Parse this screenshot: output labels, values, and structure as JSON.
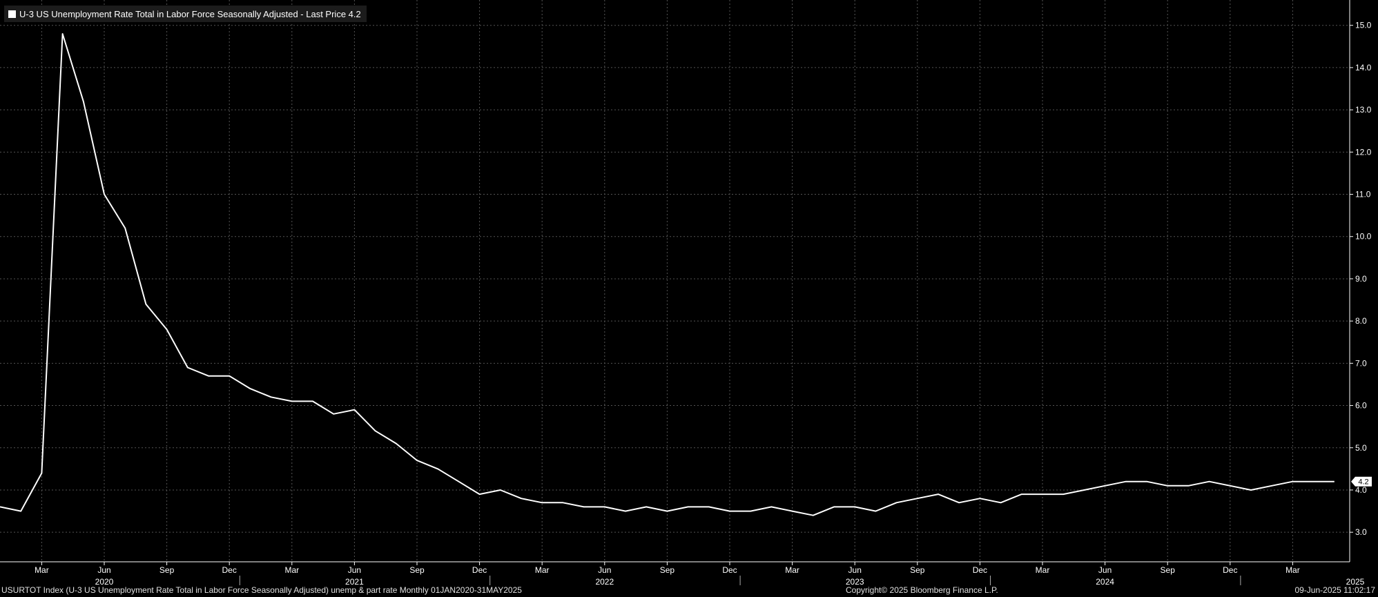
{
  "legend": {
    "label": "U-3 US Unemployment Rate Total in Labor Force Seasonally Adjusted - Last Price 4.2"
  },
  "footer": {
    "left": "USURTOT Index (U-3 US Unemployment Rate Total in Labor Force Seasonally Adjusted) unemp & part rate  Monthly 01JAN2020-31MAY2025",
    "copyright": "Copyright© 2025 Bloomberg Finance L.P.",
    "timestamp": "09-Jun-2025 11:02:17"
  },
  "colors": {
    "background": "#000000",
    "line": "#ffffff",
    "grid": "#555555"
  },
  "chart_data": {
    "type": "line",
    "title": "",
    "series": [
      {
        "name": "U-3 US Unemployment Rate Total in Labor Force Seasonally Adjusted",
        "x": [
          "2020-01",
          "2020-02",
          "2020-03",
          "2020-04",
          "2020-05",
          "2020-06",
          "2020-07",
          "2020-08",
          "2020-09",
          "2020-10",
          "2020-11",
          "2020-12",
          "2021-01",
          "2021-02",
          "2021-03",
          "2021-04",
          "2021-05",
          "2021-06",
          "2021-07",
          "2021-08",
          "2021-09",
          "2021-10",
          "2021-11",
          "2021-12",
          "2022-01",
          "2022-02",
          "2022-03",
          "2022-04",
          "2022-05",
          "2022-06",
          "2022-07",
          "2022-08",
          "2022-09",
          "2022-10",
          "2022-11",
          "2022-12",
          "2023-01",
          "2023-02",
          "2023-03",
          "2023-04",
          "2023-05",
          "2023-06",
          "2023-07",
          "2023-08",
          "2023-09",
          "2023-10",
          "2023-11",
          "2023-12",
          "2024-01",
          "2024-02",
          "2024-03",
          "2024-04",
          "2024-05",
          "2024-06",
          "2024-07",
          "2024-08",
          "2024-09",
          "2024-10",
          "2024-11",
          "2024-12",
          "2025-01",
          "2025-02",
          "2025-03",
          "2025-04",
          "2025-05"
        ],
        "values": [
          3.6,
          3.5,
          4.4,
          14.8,
          13.2,
          11.0,
          10.2,
          8.4,
          7.8,
          6.9,
          6.7,
          6.7,
          6.4,
          6.2,
          6.1,
          6.1,
          5.8,
          5.9,
          5.4,
          5.1,
          4.7,
          4.5,
          4.2,
          3.9,
          4.0,
          3.8,
          3.7,
          3.7,
          3.6,
          3.6,
          3.5,
          3.6,
          3.5,
          3.6,
          3.6,
          3.5,
          3.5,
          3.6,
          3.5,
          3.4,
          3.6,
          3.6,
          3.5,
          3.7,
          3.8,
          3.9,
          3.7,
          3.8,
          3.7,
          3.9,
          3.9,
          3.9,
          4.0,
          4.1,
          4.2,
          4.2,
          4.1,
          4.1,
          4.2,
          4.1,
          4.0,
          4.1,
          4.2,
          4.2,
          4.2
        ]
      }
    ],
    "last_value_label": "4.2",
    "ylim": [
      2.3,
      15.6
    ],
    "y_ticks": [
      "3.0",
      "4.0",
      "5.0",
      "6.0",
      "7.0",
      "8.0",
      "9.0",
      "10.0",
      "11.0",
      "12.0",
      "13.0",
      "14.0",
      "15.0"
    ],
    "y_axis_side": "right",
    "month_ticks": [
      "Mar",
      "Jun",
      "Sep",
      "Dec",
      "Mar",
      "Jun",
      "Sep",
      "Dec",
      "Mar",
      "Jun",
      "Sep",
      "Dec",
      "Mar",
      "Jun",
      "Sep",
      "Dec",
      "Mar",
      "Jun",
      "Sep",
      "Dec",
      "Mar"
    ],
    "year_labels": [
      "2020",
      "2021",
      "2022",
      "2023",
      "2024",
      "2025"
    ],
    "grid": true,
    "legend_position": "top-left"
  }
}
